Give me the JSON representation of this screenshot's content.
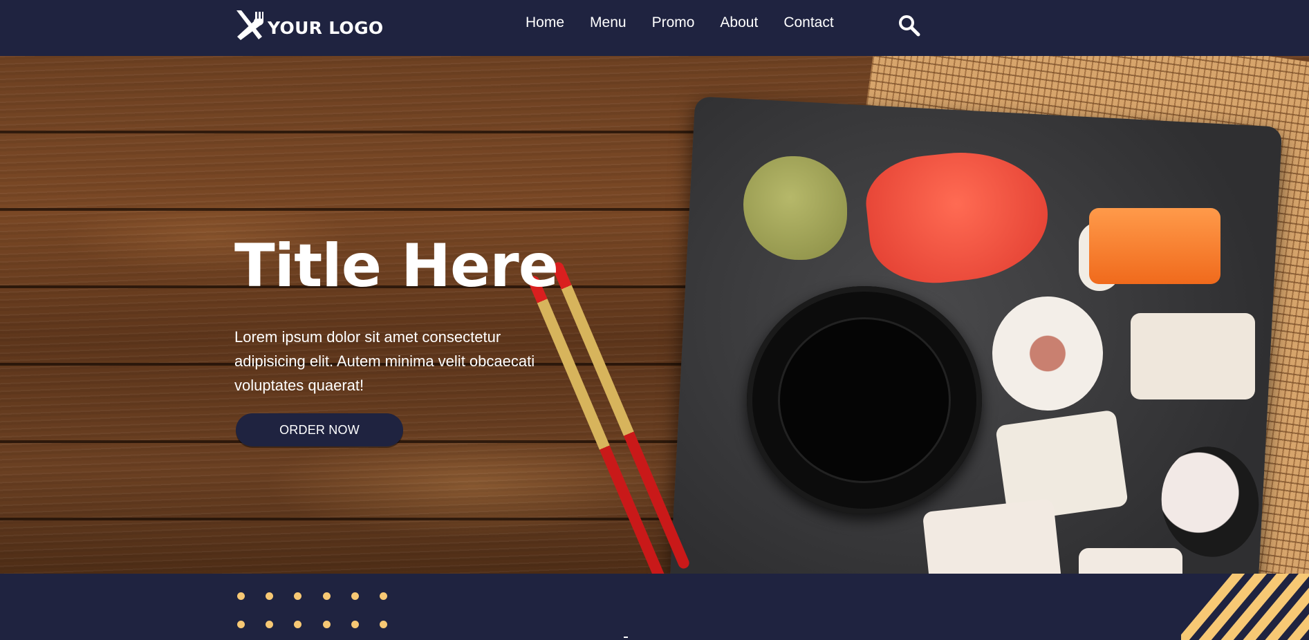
{
  "header": {
    "logo_text": "YOUR LOGO",
    "logo_icon": "fork-knife-icon",
    "nav_items": [
      {
        "label": "Home"
      },
      {
        "label": "Menu"
      },
      {
        "label": "Promo"
      },
      {
        "label": "About"
      },
      {
        "label": "Contact"
      }
    ],
    "search_icon": "search-icon"
  },
  "hero": {
    "title": "Title Here",
    "text": "Lorem ipsum dolor sit amet consectetur adipisicing elit. Autem minima velit obcaecati voluptates quaerat!",
    "button_label": "ORDER NOW"
  },
  "colors": {
    "navy": "#1f2340",
    "accent": "#f7c874",
    "white": "#ffffff"
  }
}
